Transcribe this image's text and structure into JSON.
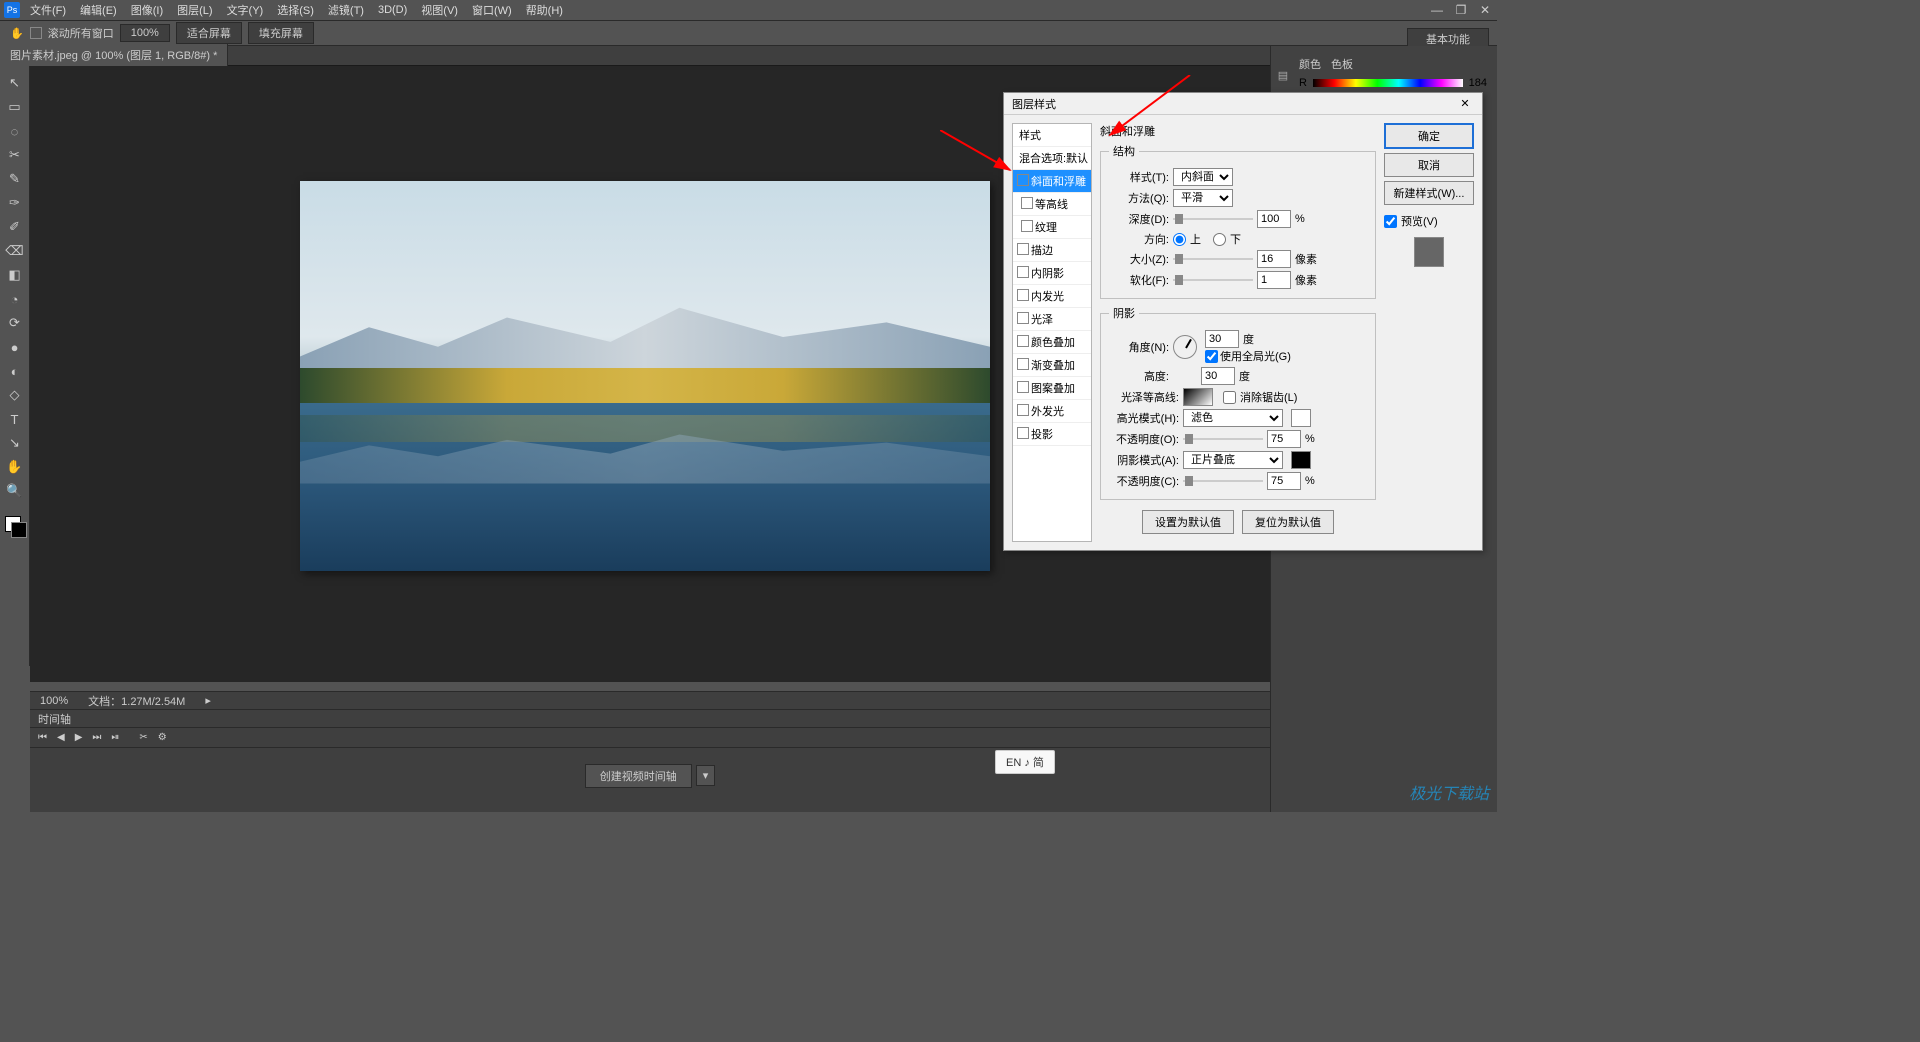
{
  "menu": {
    "items": [
      "文件(F)",
      "编辑(E)",
      "图像(I)",
      "图层(L)",
      "文字(Y)",
      "选择(S)",
      "滤镜(T)",
      "3D(D)",
      "视图(V)",
      "窗口(W)",
      "帮助(H)"
    ],
    "logo": "Ps"
  },
  "winctrl": {
    "min": "—",
    "max": "❐",
    "close": "✕"
  },
  "optbar": {
    "scroll": "滚动所有窗口",
    "zoom": "100%",
    "fit": "适合屏幕",
    "fill": "填充屏幕"
  },
  "topright": "基本功能",
  "doctab": "图片素材.jpeg @ 100% (图层 1, RGB/8#) *",
  "tools": [
    "↖",
    "▭",
    "◌",
    "✂",
    "✎",
    "✑",
    "✐",
    "⌫",
    "◧",
    "◔",
    "⟳",
    "●",
    "◐",
    "◇",
    "T",
    "↘",
    "✋",
    "🔍"
  ],
  "status": {
    "zoom": "100%",
    "doc": "文档：1.27M/2.54M"
  },
  "timeline": {
    "title": "时间轴",
    "btn": "创建视频时间轴",
    "ctrls": [
      "⏮",
      "◀",
      "▶",
      "⏭",
      "⏯",
      "✂",
      "⚙"
    ]
  },
  "rpanel": {
    "tabs": [
      "颜色",
      "色板"
    ],
    "r": "R",
    "rv": "184"
  },
  "dialog": {
    "title": "图层样式",
    "styles": [
      {
        "label": "样式",
        "type": "h"
      },
      {
        "label": "混合选项:默认",
        "type": "h"
      },
      {
        "label": "斜面和浮雕",
        "type": "chkon",
        "sel": true
      },
      {
        "label": "等高线",
        "type": "ind"
      },
      {
        "label": "纹理",
        "type": "ind"
      },
      {
        "label": "描边",
        "type": "chk"
      },
      {
        "label": "内阴影",
        "type": "chk"
      },
      {
        "label": "内发光",
        "type": "chk"
      },
      {
        "label": "光泽",
        "type": "chk"
      },
      {
        "label": "颜色叠加",
        "type": "chk"
      },
      {
        "label": "渐变叠加",
        "type": "chk"
      },
      {
        "label": "图案叠加",
        "type": "chk"
      },
      {
        "label": "外发光",
        "type": "chk"
      },
      {
        "label": "投影",
        "type": "chk"
      }
    ],
    "section1": "斜面和浮雕",
    "struct": "结构",
    "styleL": "样式(T):",
    "styleV": "内斜面",
    "methodL": "方法(Q):",
    "methodV": "平滑",
    "depthL": "深度(D):",
    "depthV": "100",
    "pct": "%",
    "dirL": "方向:",
    "up": "上",
    "down": "下",
    "sizeL": "大小(Z):",
    "sizeV": "16",
    "px": "像素",
    "softL": "软化(F):",
    "softV": "1",
    "shade": "阴影",
    "angleL": "角度(N):",
    "angleV": "30",
    "deg": "度",
    "globalL": "使用全局光(G)",
    "altL": "高度:",
    "altV": "30",
    "glossL": "光泽等高线:",
    "antiL": "消除锯齿(L)",
    "hiModeL": "高光模式(H):",
    "hiModeV": "滤色",
    "opL1": "不透明度(O):",
    "opV1": "75",
    "shModeL": "阴影模式(A):",
    "shModeV": "正片叠底",
    "opL2": "不透明度(C):",
    "opV2": "75",
    "resetD": "设置为默认值",
    "resetR": "复位为默认值",
    "ok": "确定",
    "cancel": "取消",
    "newstyle": "新建样式(W)...",
    "preview": "预览(V)"
  },
  "ime": "EN ♪ 简",
  "wm": "极光下载站"
}
